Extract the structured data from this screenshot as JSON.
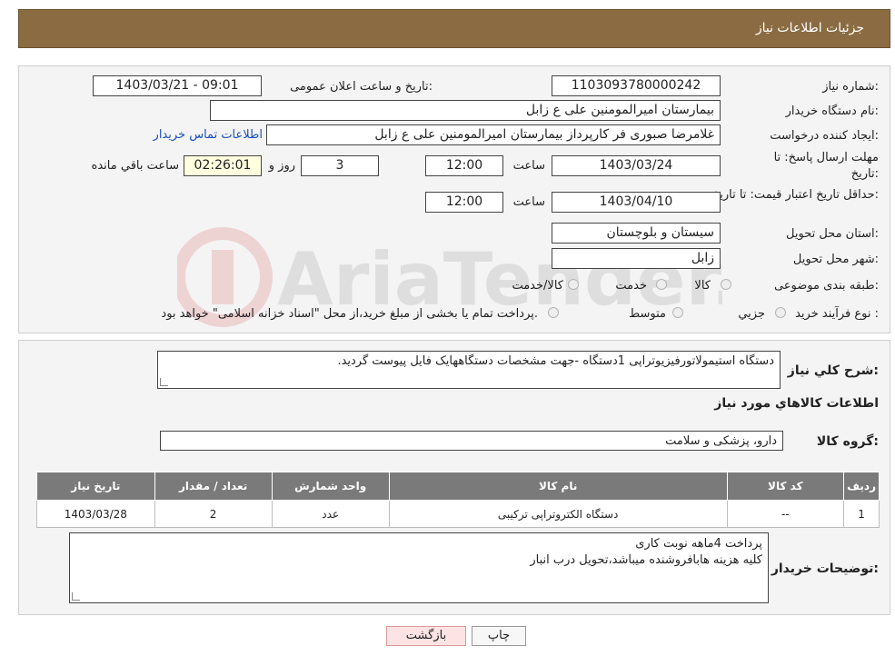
{
  "header": {
    "title": "جزئیات اطلاعات نیاز"
  },
  "fields": {
    "need_number_label": "شماره نیاز:",
    "need_number": "1103093780000242",
    "announce_label": "تاریخ و ساعت اعلان عمومی:",
    "announce_value": "1403/03/21 - 09:01",
    "buyer_org_label": "نام دستگاه خریدار:",
    "buyer_org": "بیمارستان امیرالمومنین علی  ع  زابل",
    "creator_label": "ایجاد کننده درخواست:",
    "creator": "غلامرضا صبوری فر کارپرداز بیمارستان امیرالمومنین علی  ع  زابل",
    "contact_link": "اطلاعات تماس خریدار",
    "deadline_label": "مهلت ارسال پاسخ: تا تاریخ:",
    "deadline_date": "1403/03/24",
    "time_label": "ساعت",
    "deadline_time": "12:00",
    "days": "3",
    "days_label": "روز و",
    "remaining": "02:26:01",
    "remaining_label": "ساعت باقي مانده",
    "validity_label": "حداقل تاریخ اعتبار قیمت: تا تاریخ:",
    "validity_date": "1403/04/10",
    "validity_time": "12:00",
    "province_label": "استان محل تحویل:",
    "province": "سیستان و بلوچستان",
    "city_label": "شهر محل تحویل:",
    "city": "زابل",
    "category_label": "طبقه بندی موضوعی:",
    "category_options": [
      "کالا",
      "خدمت",
      "کالا/خدمت"
    ],
    "process_label": "نوع فرآیند خرید :",
    "process_options": [
      "جزیي",
      "متوسط"
    ],
    "payment_note": "پرداخت تمام یا بخشی از مبلغ خرید،از محل \"اسناد خزانه اسلامی\" خواهد بود."
  },
  "summary": {
    "label": "شرح كلي نياز:",
    "text": "دستگاه استیمولاتورفیزیوتراپی 1دستگاه -جهت مشخصات دستگاههایک فایل پیوست گردید.",
    "items_heading": "اطلاعات كالاهاي مورد نياز",
    "group_label": "گروه كالا:",
    "group_value": "دارو، پزشکی و سلامت"
  },
  "table": {
    "headers": [
      "رديف",
      "كد كالا",
      "نام كالا",
      "واحد شمارش",
      "تعداد / مقدار",
      "تاريخ نياز"
    ],
    "rows": [
      [
        "1",
        "--",
        "دستگاه الکتروتراپی ترکیبی",
        "عدد",
        "2",
        "1403/03/28"
      ]
    ]
  },
  "buyer_notes": {
    "label": "توضیحات خریدار:",
    "line1": "پرداخت 4ماهه نوبت کاری",
    "line2": "کلیه هزینه هابافروشنده میباشد،تحویل درب انبار"
  },
  "buttons": {
    "print": "چاپ",
    "back": "بازگشت"
  },
  "watermark": "AriaTender.neT"
}
